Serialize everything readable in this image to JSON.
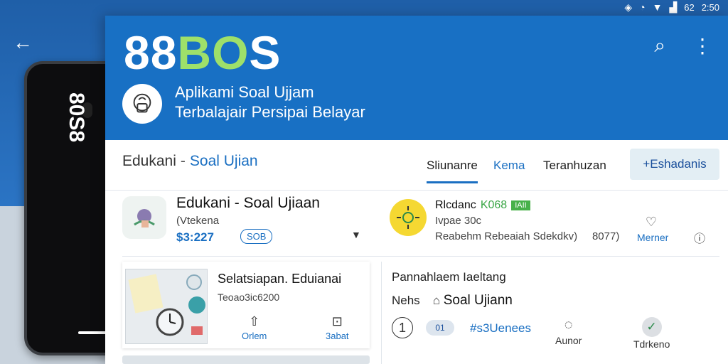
{
  "status_bar": {
    "time": "2:50",
    "extra": "62",
    "icons": [
      "sync-icon",
      "alarm-icon",
      "wifi-icon",
      "signal-icon"
    ]
  },
  "nav": {
    "back_icon": "back-arrow-icon"
  },
  "phone": {
    "screen_text": "80S8"
  },
  "header": {
    "logo_main": "88",
    "logo_accent": "BO",
    "logo_tail": "S",
    "tagline_line1": "Aplikami Soal Ujjam",
    "tagline_line2": "Terbalajair Persipai Belayar",
    "icons": [
      "search-icon",
      "more-vert-icon"
    ]
  },
  "breadcrumb": {
    "parent": "Edukani",
    "separator": "-",
    "current": "Soal Ujian"
  },
  "tabs": [
    {
      "label": "Sliunanre"
    },
    {
      "label": "Kema"
    },
    {
      "label": "Teranhuzan"
    }
  ],
  "tab_button": {
    "label": "+Eshadanis"
  },
  "card_a": {
    "title": "Edukani  - Soal Ujiaan",
    "subtitle": "(Vtekena",
    "price": "$3:227",
    "badge": "SOB"
  },
  "card_b": {
    "title": "Rlcdanc",
    "title_green": "K068",
    "tag": "IAII",
    "subtitle": "Ivpae 30c",
    "meta_left": "Reabehm Rebeaiah Sdekdkv)",
    "meta_right": "8077)",
    "like_label": "Merner"
  },
  "card_c": {
    "title": "Selatsiapan. Eduianai",
    "subtitle": "Teoao3ic6200",
    "action_left": "Orlem",
    "action_right": "3abat"
  },
  "card_d": {
    "title": "Pannahlaem Iaeltang",
    "row_label": "Nehs",
    "row_value": "Soal Ujiann",
    "circle_num": "1",
    "pill": "01",
    "num_text": "#s3Uenees",
    "action1": "Aunor",
    "action2": "Tdrkeno"
  },
  "colors": {
    "brand_blue": "#1870c4",
    "accent_green": "#9ee06a",
    "link_blue": "#1a6fc2"
  }
}
